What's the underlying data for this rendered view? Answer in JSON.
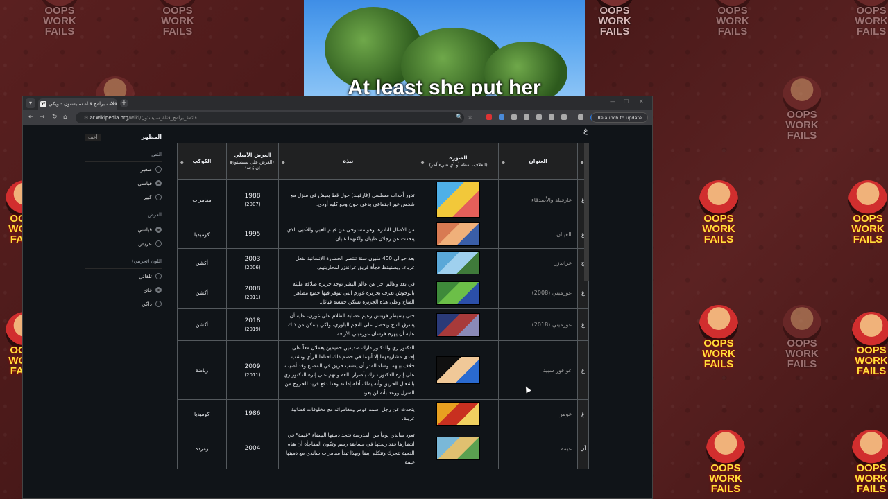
{
  "background": {
    "logo_text_line1": "OOPS",
    "logo_text_line2": "WORK FAILS"
  },
  "video": {
    "caption": "At least she put her"
  },
  "browser": {
    "tab_title": "قائمة برامج قناة سبيستون - ويكي",
    "tab_favicon": "W",
    "url_host": "ar.wikipedia.org",
    "url_path": "/wiki/قائمة_برامج_قناة_سبيستون",
    "relaunch_label": "Relaunch to update",
    "avatar_letter": "N"
  },
  "sidebar": {
    "title": "المظهر",
    "hide_label": "أخف",
    "text_section": "النص",
    "text_options": [
      {
        "label": "صغير",
        "selected": false
      },
      {
        "label": "قياسي",
        "selected": true
      },
      {
        "label": "كبير",
        "selected": false
      }
    ],
    "width_section": "العرض",
    "width_options": [
      {
        "label": "قياسي",
        "selected": true
      },
      {
        "label": "عريض",
        "selected": false
      }
    ],
    "color_section": "اللون (تجريبي)",
    "color_options": [
      {
        "label": "تلقائي",
        "selected": false
      },
      {
        "label": "فاتح",
        "selected": true
      },
      {
        "label": "داكن",
        "selected": false
      }
    ]
  },
  "table": {
    "section_letter": "غ",
    "headers": {
      "title": "العنوان",
      "image": "الصورة",
      "image_sub": "(الغلاف، لقطة أو أي شيء آخر)",
      "summary": "نبذة",
      "original": "العرض الأصلي",
      "original_sub": "(العرض على سبيستون إن وُجد)",
      "planet": "الكوكب"
    },
    "rows": [
      {
        "letter": "غ",
        "title": "غارفيلد والأصدقاء",
        "summary": "تدور أحداث مسلسل (غارفيلد) حول قط يعيش في منزل مع شخص غير اجتماعي يدعى جون ومع كلبه أودي.",
        "year": "1988",
        "year2": "(2007)",
        "planet": "مغامرات",
        "thumb_colors": [
          "#4fb0e8",
          "#f2c83a",
          "#e45f5a"
        ]
      },
      {
        "letter": "غ",
        "title": "الغيبان",
        "summary": "من الأصال النادرة، وهو مستوحى من فيلم الغبي والأغبى الذي يتحدث عن رجلان طيبان ولكنهما غبيان.",
        "year": "1995",
        "year2": "",
        "planet": "كوميديا",
        "thumb_colors": [
          "#d87a52",
          "#f0b07a",
          "#3a5ea8"
        ]
      },
      {
        "letter": "ج",
        "title": "غراندزر",
        "summary": "بعد حوالي 400 مليون سنة تنتصر الحضارة الإنسانية بفعل غرباء، ويستيقظ فجأة فريق غراندزر لمحاربتهم.",
        "year": "2003",
        "year2": "(2006)",
        "planet": "أكشن",
        "thumb_colors": [
          "#5aa8d8",
          "#9fd0ee",
          "#3f7a3a"
        ]
      },
      {
        "letter": "غ",
        "title": "غورميتي (2008)",
        "summary": "في بعد وعالم آخر عن عالم البشر توجد جزيرة صلاقة مليئة بالوحوش تعرف بجزيرة غورم التي تتوفر فيها جميع مظاهر المناخ وعلى هذه الجزيرة تسكن خمسة قبائل.",
        "year": "2008",
        "year2": "(2011)",
        "planet": "أكشن",
        "thumb_colors": [
          "#3e8a3a",
          "#6cbf48",
          "#2b4fa8"
        ]
      },
      {
        "letter": "غ",
        "title": "غورميتي (2018)",
        "summary": "حتى يسيطر فويتس زعيم عصابة الظلام على غورن، عليه أن يسرق التاج ويحصل على النجم البلوري، ولكي يتمكن من ذلك عليه أن يهزم فرسان غورميتي الأربعة.",
        "year": "2018",
        "year2": "(2019)",
        "planet": "أكشن",
        "thumb_colors": [
          "#2a3a78",
          "#a83a3a",
          "#8a8ab8"
        ]
      },
      {
        "letter": "غ",
        "title": "غو فور سبيد",
        "summary": "الدكتور ري والدكتور دارك صديقين حميمين يعملان معاً على إحدى مشاريعهما إلا أنهما في خضم ذلك اختلفا الرأي ونشب خلاف بينهما وشاء القدر أن ينشب حريق في المصنع وقد أصيب على إثره الدكتور دارك بأضرار بالغة واتهم على إثره الدكتور ري باشعال الحريق وأنه يملك أدلة إدانته وهذا دفع فريد للخروج من المنزل ووعد بأنه لن يعود.",
        "year": "2009",
        "year2": "(2011)",
        "planet": "رياضة",
        "thumb_colors": [
          "#101010",
          "#f0c898",
          "#2a6ad0"
        ]
      },
      {
        "letter": "غ",
        "title": "غومر",
        "summary": "يتحدث عن رجل اسمه غومر ومغامراته مع مخلوقات فضائية غريبة.",
        "year": "1986",
        "year2": "",
        "planet": "كوميديا",
        "thumb_colors": [
          "#e8a020",
          "#c83020",
          "#f0d060"
        ]
      },
      {
        "letter": "أن",
        "title": "غيمة",
        "summary": "تعود ساندي يوماً من المدرسة فتجد دميتها البيضاء \"غيمة\" في انتظارها فقد ربحتها في مسابقة رسم وتكون المفاجأة أن هذه الدمية تتحرك وتتكلم أيضا وبهذا تبدأ مغامرات ساندي مع دميتها غيمة.",
        "year": "2004",
        "year2": "",
        "planet": "زمرده",
        "thumb_colors": [
          "#7ab8d8",
          "#e0c070",
          "#5aa050"
        ]
      }
    ]
  },
  "colors": {
    "page_bg": "#101418",
    "table_border": "#54595d",
    "header_bg": "#202122",
    "wallpaper": "#4f1c1c",
    "logo_yellow": "#ffe03a"
  }
}
